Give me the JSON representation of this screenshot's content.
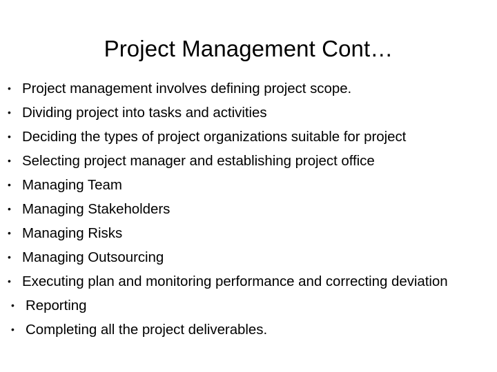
{
  "slide": {
    "title": "Project Management Cont…",
    "bullet_marker": "•",
    "background_color": "#ffffff",
    "text_color": "#000000",
    "bullets": [
      {
        "text": "Project management involves defining project scope.",
        "indented": false
      },
      {
        "text": "Dividing project into tasks and activities",
        "indented": false
      },
      {
        "text": "Deciding  the types of project organizations suitable for project",
        "indented": false
      },
      {
        "text": "Selecting project manager and establishing project office",
        "indented": false
      },
      {
        "text": "Managing Team",
        "indented": false
      },
      {
        "text": "Managing Stakeholders",
        "indented": false
      },
      {
        "text": "Managing Risks",
        "indented": false
      },
      {
        "text": "Managing Outsourcing",
        "indented": false
      },
      {
        "text": "Executing plan and monitoring performance and correcting deviation",
        "indented": false
      },
      {
        "text": "Reporting",
        "indented": true
      },
      {
        "text": "Completing all the project deliverables.",
        "indented": true
      }
    ]
  }
}
